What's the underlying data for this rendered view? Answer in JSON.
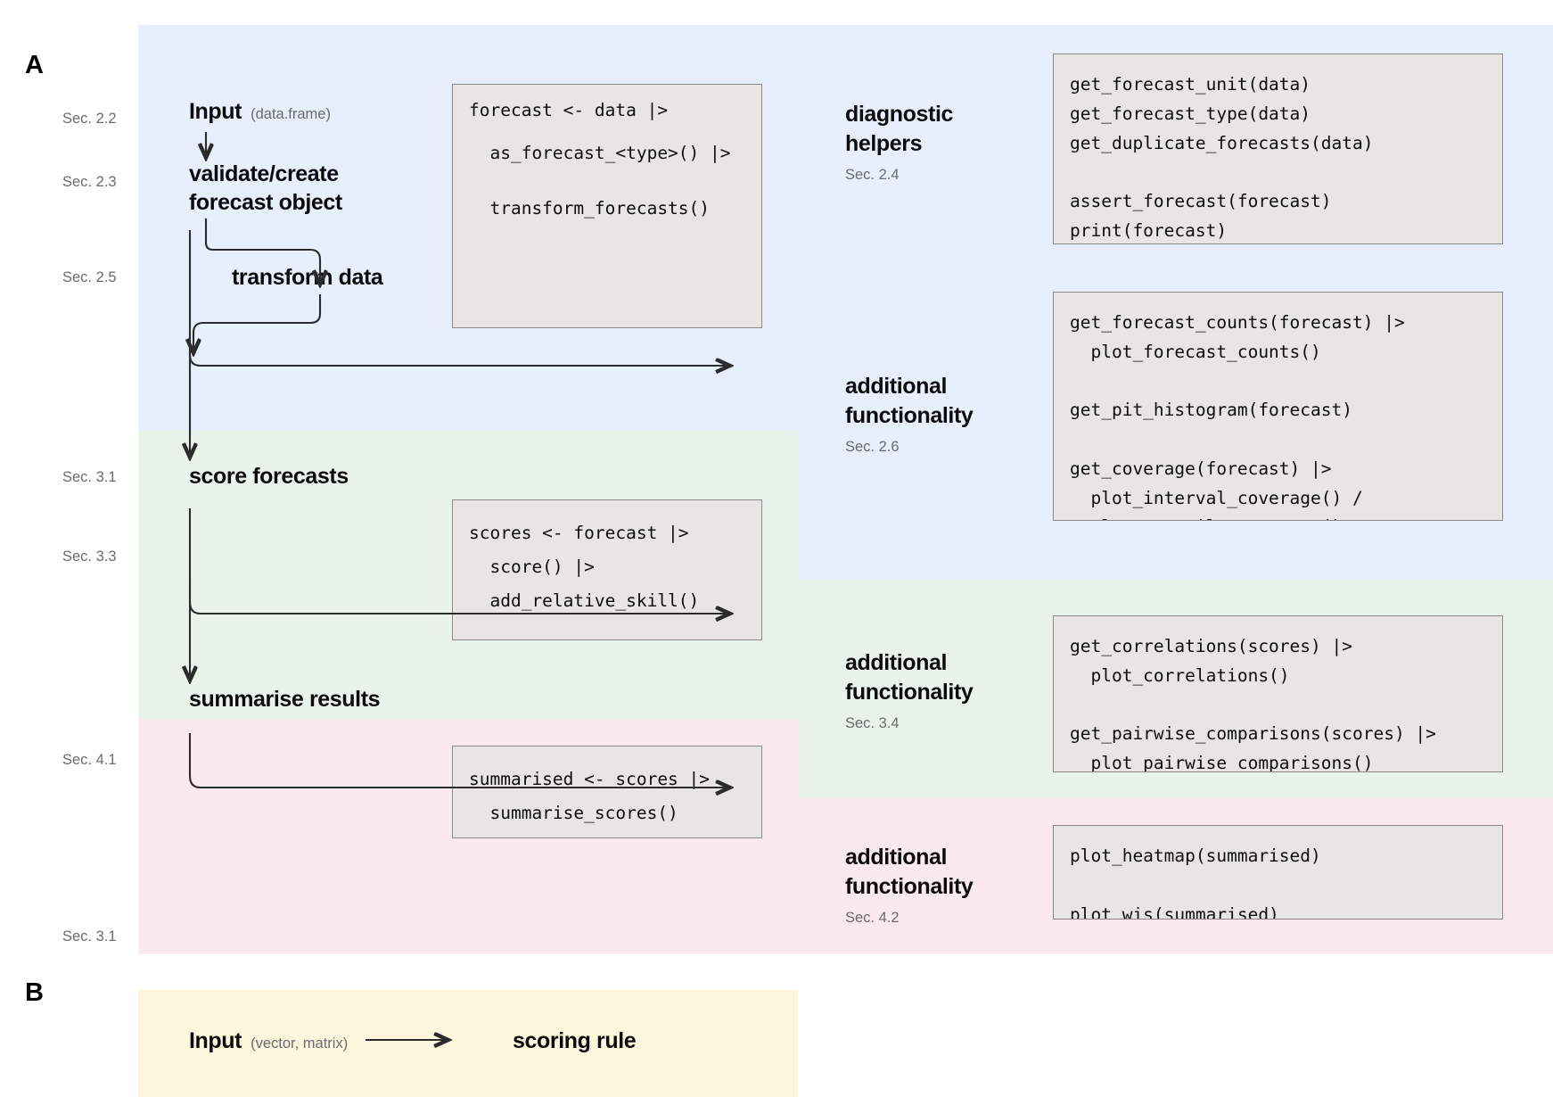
{
  "panels": {
    "a_label": "A",
    "b_label": "B"
  },
  "sections": {
    "blue": {
      "color": "#e6effb",
      "name": "forecast-section"
    },
    "green": {
      "color": "#eaf3ea",
      "name": "scoring-section"
    },
    "pink": {
      "color": "#fbeaed",
      "name": "summarise-section"
    },
    "yellow": {
      "color": "#fcf6dd",
      "name": "scoring-rule-section"
    }
  },
  "sec_labels": {
    "input": "Sec. 2.2",
    "validate": "Sec. 2.3",
    "transform": "Sec. 2.5",
    "score": "Sec. 3.1",
    "score_extra": "Sec. 3.3",
    "summarise": "Sec. 4.1",
    "panel_b": "Sec. 3.1"
  },
  "steps": {
    "input_label": "Input",
    "input_sub": "(data.frame)",
    "validate_label": "validate/create\nforecast object",
    "transform_label": "transform data",
    "score_label": "score forecasts",
    "summarise_label": "summarise results"
  },
  "right_groups": [
    {
      "title": "diagnostic\nhelpers",
      "sec": "Sec. 2.4",
      "code": "get_forecast_unit(data)\nget_forecast_type(data)\nget_duplicate_forecasts(data)\n\nassert_forecast(forecast)\nprint(forecast)"
    },
    {
      "title": "additional\nfunctionality",
      "sec": "Sec. 2.6",
      "code": "get_forecast_counts(forecast) |>\n  plot_forecast_counts()\n\nget_pit_histogram(forecast)\n\nget_coverage(forecast) |>\n  plot_interval_coverage() /\n  plot_quantile_coverage()"
    },
    {
      "title": "additional\nfunctionality",
      "sec": "Sec. 3.4",
      "code": "get_correlations(scores) |>\n  plot_correlations()\n\nget_pairwise_comparisons(scores) |>\n  plot_pairwise_comparisons()"
    },
    {
      "title": "additional\nfunctionality",
      "sec": "Sec. 4.2",
      "code": "plot_heatmap(summarised)\n\nplot_wis(summarised)"
    }
  ],
  "pipeline_code": {
    "forecast": {
      "line1": "forecast <- data |>",
      "line2": "  as_forecast_<type>() |>",
      "line3": "  transform_forecasts()"
    },
    "score": "scores <- forecast |>\n  score() |>\n  add_relative_skill()",
    "summarise": "summarised <- scores |>\n  summarise_scores()"
  },
  "panel_b": {
    "input_label": "Input",
    "input_sub": "(vector, matrix)",
    "target_label": "scoring rule"
  },
  "colors": {
    "code_bg": "#e8e6e3",
    "code_border": "#8a8a8a",
    "arrow": "#2b2b2b",
    "muted_text": "#6b6b6b",
    "body_text": "#0c0c0c"
  }
}
